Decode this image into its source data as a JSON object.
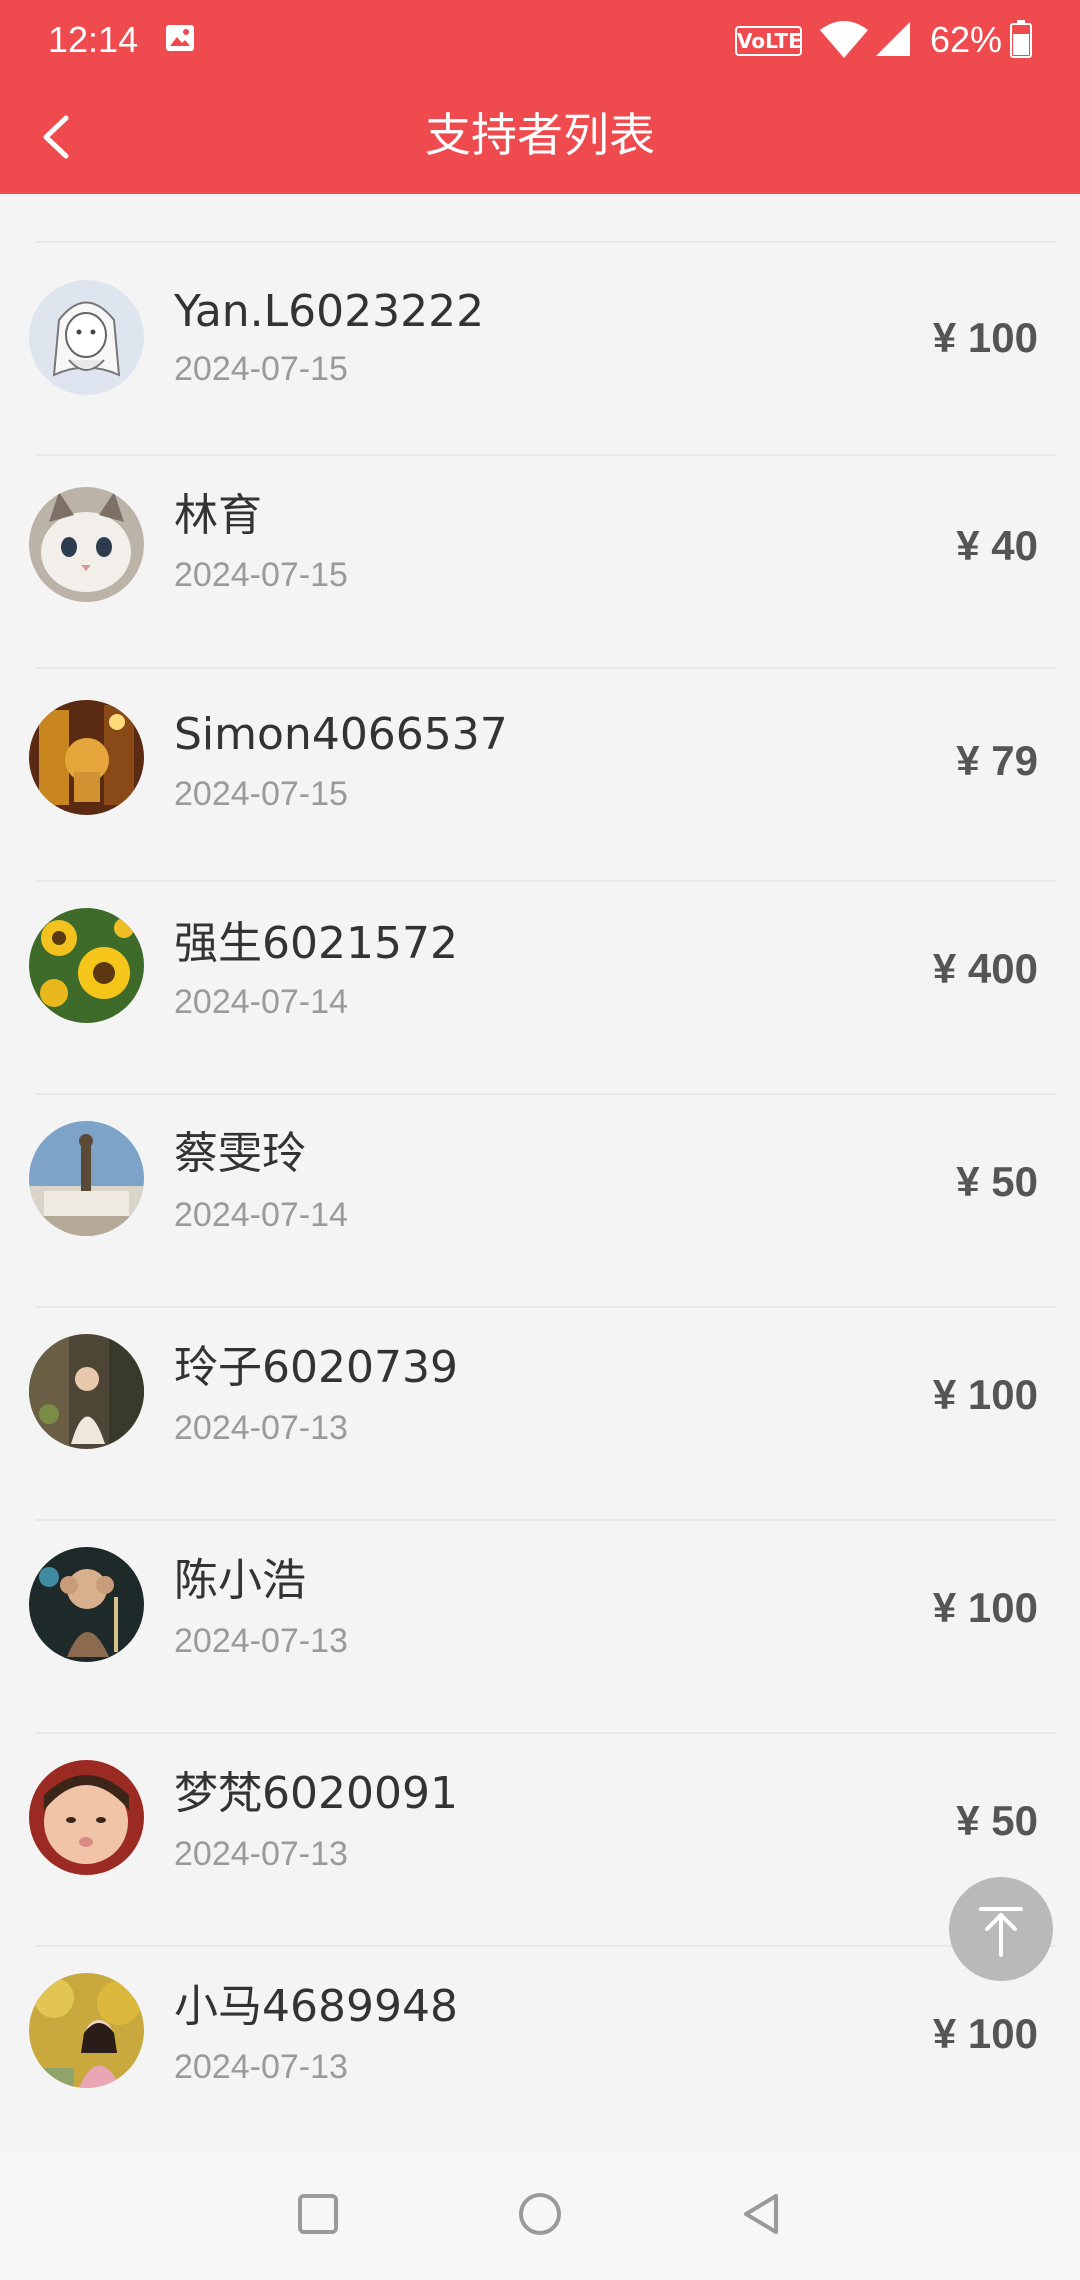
{
  "status_bar": {
    "time": "12:14",
    "volte_label": "VoLTE",
    "battery_percent": "62%",
    "icons": [
      "gallery-icon",
      "wifi-icon",
      "signal-icon",
      "battery-icon"
    ]
  },
  "header": {
    "title": "支持者列表",
    "back_icon": "chevron-left-icon",
    "background_color": "#ef4a4e"
  },
  "supporters": [
    {
      "name": "Yan.L6023222",
      "date": "2024-07-15",
      "amount": "¥ 100"
    },
    {
      "name": "林育",
      "date": "2024-07-15",
      "amount": "¥ 40"
    },
    {
      "name": "Simon4066537",
      "date": "2024-07-15",
      "amount": "¥ 79"
    },
    {
      "name": "强生6021572",
      "date": "2024-07-14",
      "amount": "¥ 400"
    },
    {
      "name": "蔡雯玲",
      "date": "2024-07-14",
      "amount": "¥ 50"
    },
    {
      "name": "玲子6020739",
      "date": "2024-07-13",
      "amount": "¥ 100"
    },
    {
      "name": "陈小浩",
      "date": "2024-07-13",
      "amount": "¥ 100"
    },
    {
      "name": "梦梵6020091",
      "date": "2024-07-13",
      "amount": "¥ 50"
    },
    {
      "name": "小马4689948",
      "date": "2024-07-13",
      "amount": "¥ 100"
    }
  ],
  "scroll_top_icon": "arrow-to-top-icon",
  "system_nav": [
    "recents-icon",
    "home-icon",
    "back-triangle-icon"
  ]
}
